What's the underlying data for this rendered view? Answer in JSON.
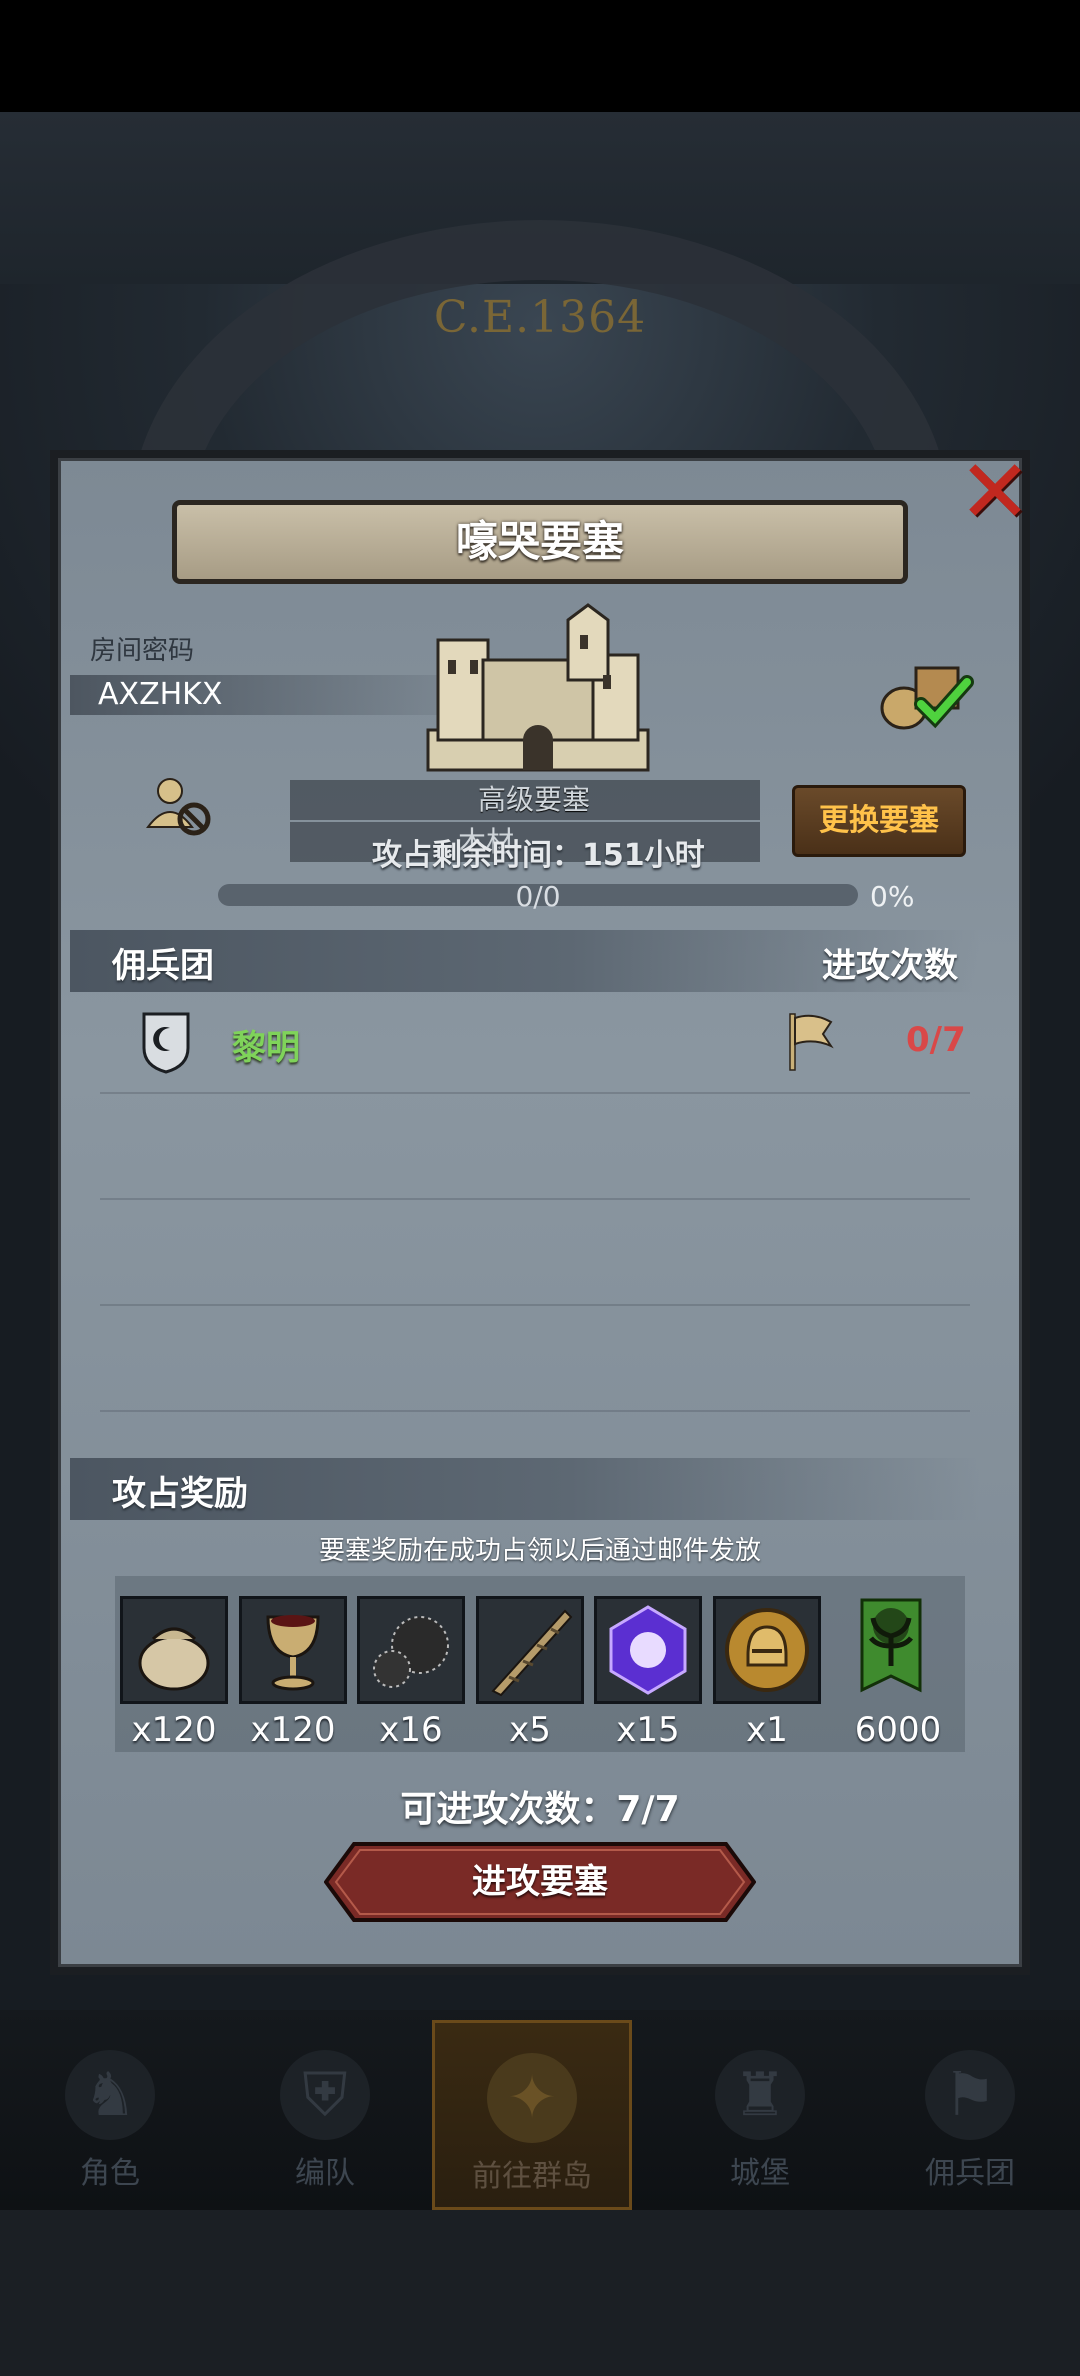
{
  "background": {
    "era": "C.E.1364"
  },
  "dialog": {
    "title": "嚎哭要塞",
    "close_icon": "close-x-icon",
    "room": {
      "label": "房间密码",
      "code": "AXZHKX"
    },
    "fortress": {
      "level": "高级要塞",
      "resource": "木材",
      "remaining_time": "攻占剩余时间：151小时",
      "change_button": "更换要塞",
      "progress_text": "0/0",
      "progress_percent": "0%",
      "progress_value": 0
    },
    "mercenary": {
      "header_left": "佣兵团",
      "header_right": "进攻次数",
      "rows": [
        {
          "name": "黎明",
          "count": "0/7"
        }
      ]
    },
    "rewards": {
      "header": "攻占奖励",
      "hint": "要塞奖励在成功占领以后通过邮件发放",
      "items": [
        {
          "icon": "sack-icon",
          "qty": "x120"
        },
        {
          "icon": "goblet-icon",
          "qty": "x120"
        },
        {
          "icon": "ore-icon",
          "qty": "x16"
        },
        {
          "icon": "horn-icon",
          "qty": "x5"
        },
        {
          "icon": "purple-gem-icon",
          "qty": "x15"
        },
        {
          "icon": "helmet-coin-icon",
          "qty": "x1"
        },
        {
          "icon": "tree-banner-icon",
          "qty": "6000"
        }
      ]
    },
    "attempts": "可进攻次数：7/7",
    "attack_button": "进攻要塞"
  },
  "nav": [
    {
      "label": "角色",
      "active": false
    },
    {
      "label": "编队",
      "active": false
    },
    {
      "label": "前往群岛",
      "active": true
    },
    {
      "label": "城堡",
      "active": false
    },
    {
      "label": "佣兵团",
      "active": false
    }
  ],
  "colors": {
    "accent_gold": "#ffc24a",
    "guild_green": "#7fd35a",
    "count_red": "#d94848",
    "close_red": "#c1281f"
  }
}
